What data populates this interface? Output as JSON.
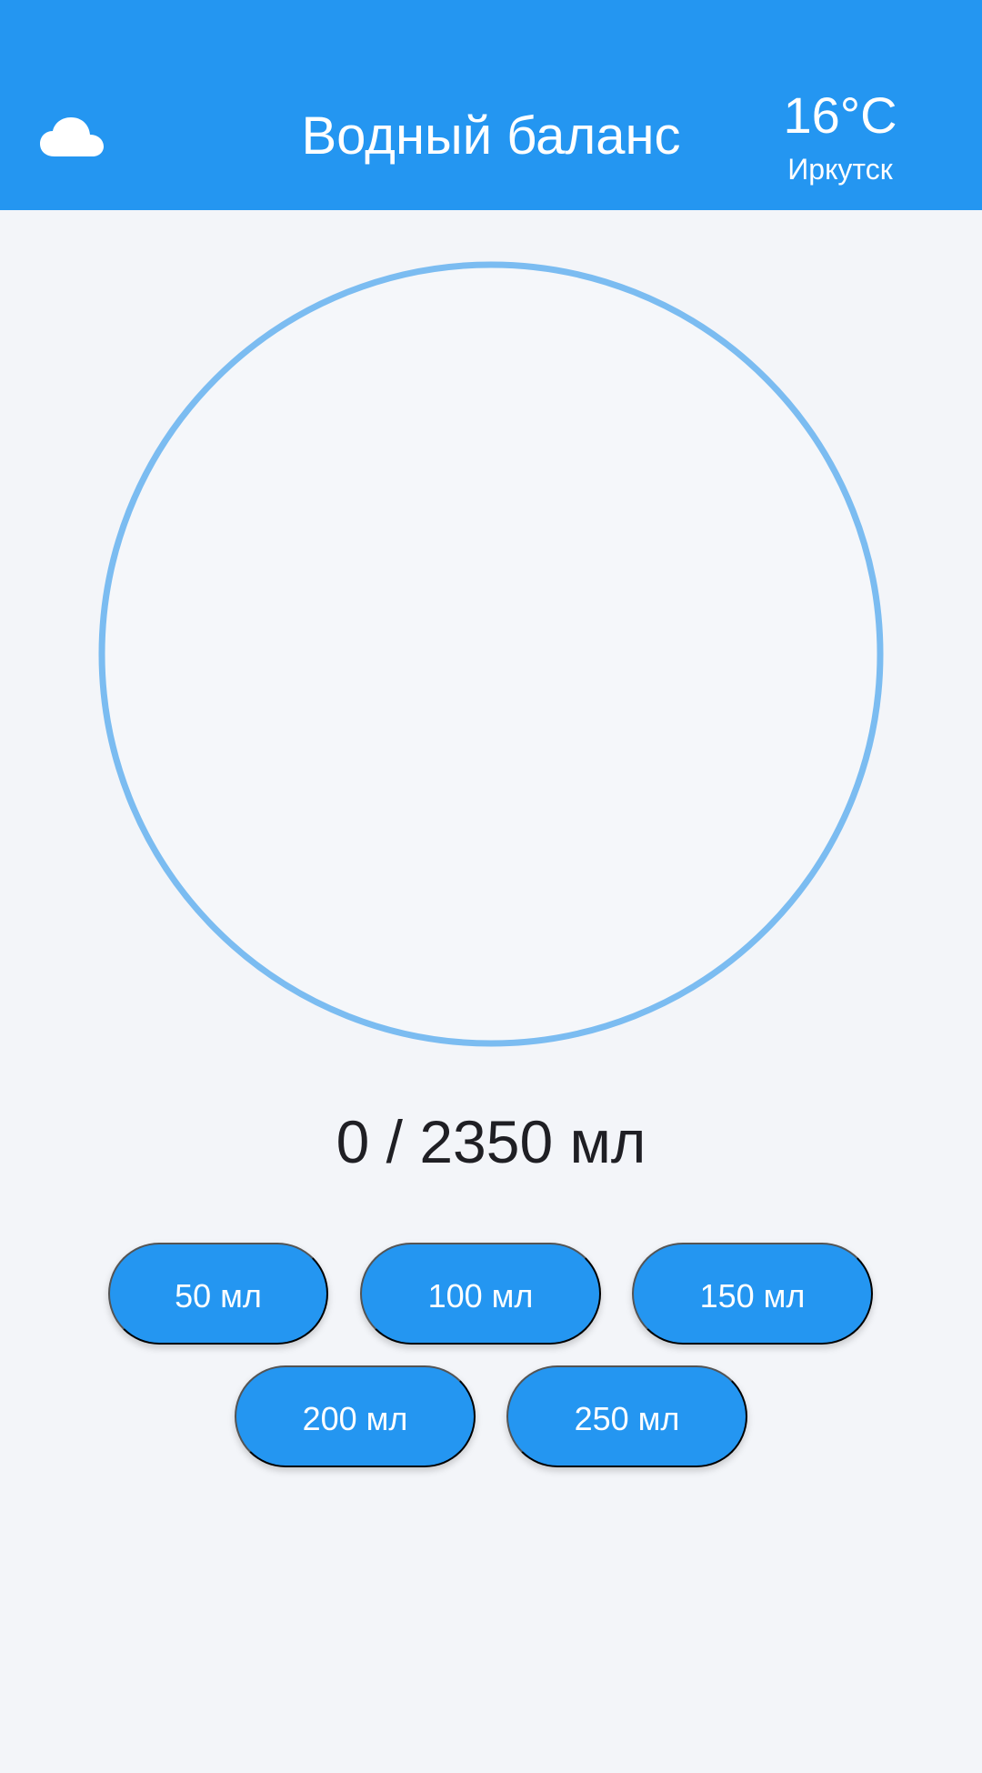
{
  "header": {
    "title": "Водный баланс",
    "weather_icon": "cloud-icon",
    "temperature": "16°C",
    "city": "Иркутск"
  },
  "progress": {
    "current_ml": 0,
    "goal_ml": 2350,
    "fraction_filled": 0,
    "label": "0 / 2350 мл"
  },
  "buttons": [
    {
      "label": "50 мл"
    },
    {
      "label": "100 мл"
    },
    {
      "label": "150 мл"
    },
    {
      "label": "200 мл"
    },
    {
      "label": "250 мл"
    }
  ],
  "colors": {
    "primary": "#2496F1",
    "ring": "#7BBCF1",
    "background": "#F3F5F9",
    "text_dark": "#1F1F24"
  }
}
